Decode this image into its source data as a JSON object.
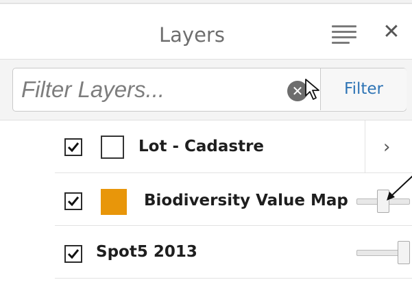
{
  "panel": {
    "title": "Layers",
    "menu_icon": "hamburger-menu-icon",
    "close_icon": "close-icon",
    "close_glyph": "✕"
  },
  "filter": {
    "placeholder": "Filter Layers...",
    "value": "",
    "clear_icon": "clear-circle-icon",
    "clear_glyph": "✕",
    "button_label": "Filter"
  },
  "layers": [
    {
      "name": "Lot - Cadastre",
      "checked": true,
      "swatch": "empty-square",
      "has_expand": true,
      "expand_glyph": "›"
    },
    {
      "name": "Biodiversity Value Map",
      "checked": true,
      "swatch": "filled-square",
      "swatch_color": "#e8960a",
      "opacity": 0.5
    },
    {
      "name": "Spot5 2013",
      "checked": true,
      "swatch": "none",
      "opacity": 1.0
    }
  ],
  "colors": {
    "accent": "#2e74b5",
    "swatch_orange": "#e8960a"
  }
}
